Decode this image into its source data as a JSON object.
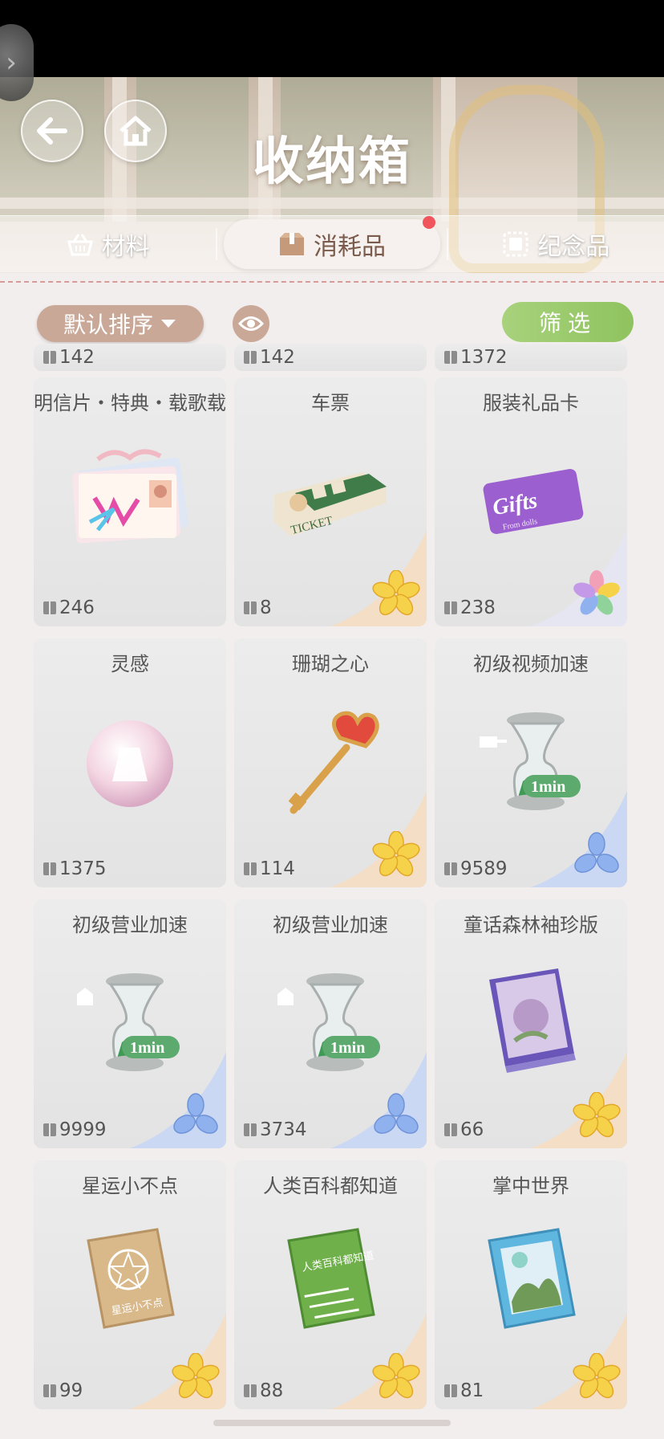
{
  "header": {
    "title": "收纳箱",
    "back_icon": "arrow-left-icon",
    "home_icon": "home-icon"
  },
  "tabs": [
    {
      "label": "材料",
      "icon": "basket-icon",
      "active": false
    },
    {
      "label": "消耗品",
      "icon": "package-icon",
      "active": true,
      "badge": true
    },
    {
      "label": "纪念品",
      "icon": "stamp-icon",
      "active": false
    }
  ],
  "toolbar": {
    "sort_label": "默认排序",
    "filter_label": "筛选",
    "eye_icon": "eye-icon"
  },
  "partial_row": [
    {
      "count": "142"
    },
    {
      "count": "142"
    },
    {
      "count": "1372"
    }
  ],
  "items": [
    {
      "name": "明信片・特典・载歌载",
      "count": "246",
      "icon": "postcard-icon",
      "rarity": "none"
    },
    {
      "name": "车票",
      "count": "8",
      "icon": "ticket-icon",
      "rarity": "gold"
    },
    {
      "name": "服装礼品卡",
      "count": "238",
      "icon": "gift-card-icon",
      "rarity": "rainbow"
    },
    {
      "name": "灵感",
      "count": "1375",
      "icon": "inspiration-orb-icon",
      "rarity": "none"
    },
    {
      "name": "珊瑚之心",
      "count": "114",
      "icon": "heart-key-icon",
      "rarity": "gold"
    },
    {
      "name": "初级视频加速",
      "count": "9589",
      "icon": "hourglass-icon",
      "rarity": "blue"
    },
    {
      "name": "初级营业加速",
      "count": "9999",
      "icon": "hourglass-icon",
      "rarity": "blue"
    },
    {
      "name": "初级营业加速",
      "count": "3734",
      "icon": "hourglass-icon",
      "rarity": "blue"
    },
    {
      "name": "童话森林袖珍版",
      "count": "66",
      "icon": "book-purple-icon",
      "rarity": "gold"
    },
    {
      "name": "星运小不点",
      "count": "99",
      "icon": "book-tan-icon",
      "rarity": "gold"
    },
    {
      "name": "人类百科都知道",
      "count": "88",
      "icon": "book-green-icon",
      "rarity": "gold"
    },
    {
      "name": "掌中世界",
      "count": "81",
      "icon": "book-blue-icon",
      "rarity": "gold"
    }
  ],
  "icon_texts": {
    "ticket": "TICKET",
    "gift": "Gifts",
    "gift_sub": "From dolls",
    "speed": "1min",
    "book1": "星运小不点",
    "book2": "人类百科都知道"
  },
  "colors": {
    "accent_brown": "#c9a898",
    "filter_green": "#8fc35f",
    "badge_red": "#f0545c",
    "gold_rarity": "#f6d24a",
    "blue_rarity": "#8fb2ee"
  }
}
